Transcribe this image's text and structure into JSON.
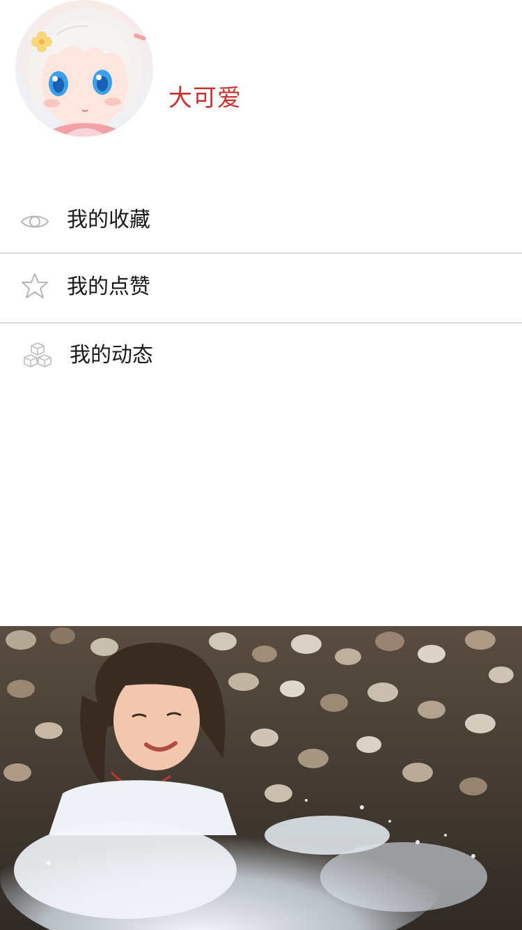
{
  "profile": {
    "avatar_icon": "anime-girl-avatar",
    "username": "大可爱"
  },
  "menu": {
    "items": [
      {
        "icon": "eye-icon",
        "label": "我的收藏"
      },
      {
        "icon": "star-icon",
        "label": "我的点赞"
      },
      {
        "icon": "cubes-icon",
        "label": "我的动态"
      }
    ]
  },
  "banner": {
    "image": "photo-girl-splashing-water"
  },
  "colors": {
    "accent": "#c8312c",
    "text": "#1a1a1a",
    "divider": "#d9d9d9",
    "icon": "#b5b5b5"
  }
}
